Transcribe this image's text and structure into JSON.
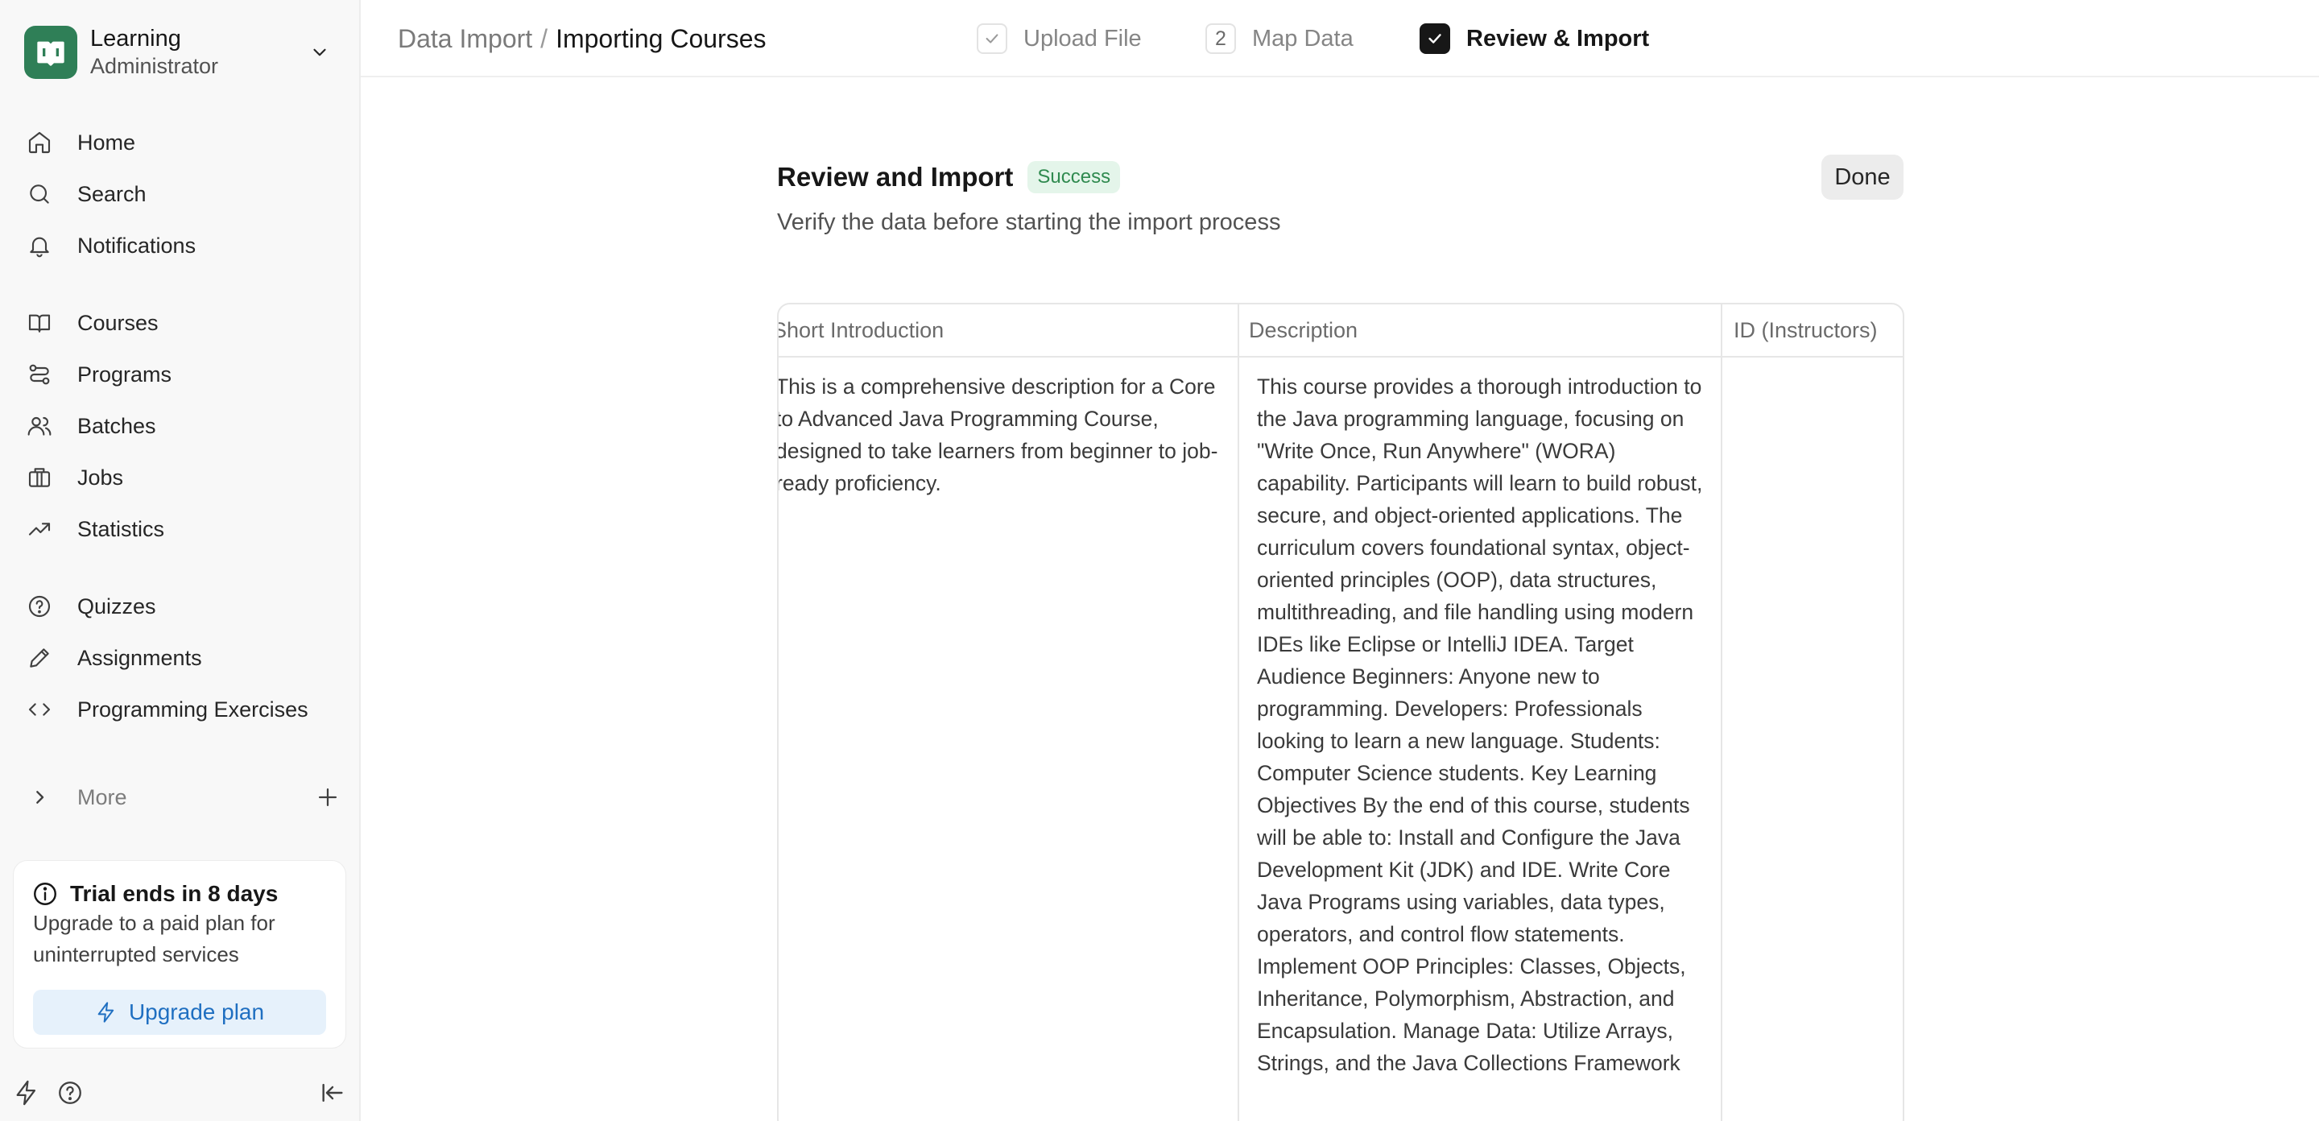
{
  "sidebar": {
    "brand": {
      "title": "Learning",
      "subtitle": "Administrator"
    },
    "nav_primary": [
      {
        "label": "Home",
        "icon": "home-icon"
      },
      {
        "label": "Search",
        "icon": "search-icon"
      },
      {
        "label": "Notifications",
        "icon": "bell-icon"
      }
    ],
    "nav_content": [
      {
        "label": "Courses",
        "icon": "book-icon"
      },
      {
        "label": "Programs",
        "icon": "route-icon"
      },
      {
        "label": "Batches",
        "icon": "users-icon"
      },
      {
        "label": "Jobs",
        "icon": "briefcase-icon"
      },
      {
        "label": "Statistics",
        "icon": "trending-up-icon"
      }
    ],
    "nav_assess": [
      {
        "label": "Quizzes",
        "icon": "help-circle-icon"
      },
      {
        "label": "Assignments",
        "icon": "pencil-icon"
      },
      {
        "label": "Programming Exercises",
        "icon": "code-icon"
      }
    ],
    "more_label": "More",
    "trial": {
      "title": "Trial ends in 8 days",
      "text": "Upgrade to a paid plan for uninterrupted services",
      "button": "Upgrade plan"
    }
  },
  "topbar": {
    "breadcrumb_parent": "Data Import",
    "breadcrumb_separator": "/",
    "breadcrumb_current": "Importing Courses",
    "steps": [
      {
        "marker": "✓",
        "label": "Upload File"
      },
      {
        "marker": "2",
        "label": "Map Data"
      },
      {
        "marker": "✓",
        "label": "Review & Import"
      }
    ]
  },
  "main": {
    "title": "Review and Import",
    "status_badge": "Success",
    "subtitle": "Verify the data before starting the import process",
    "done_label": "Done",
    "table": {
      "columns": [
        "Short Introduction",
        "Description",
        "ID (Instructors)"
      ],
      "rows": [
        {
          "short_introduction": "This is a comprehensive description for a Core to Advanced Java Programming Course, designed to take learners from beginner to job-ready proficiency.",
          "description": "This course provides a thorough introduction to the Java programming language, focusing on \"Write Once, Run Anywhere\" (WORA) capability. Participants will learn to build robust, secure, and object-oriented applications. The curriculum covers foundational syntax, object-oriented principles (OOP), data structures, multithreading, and file handling using modern IDEs like Eclipse or IntelliJ IDEA. Target Audience Beginners: Anyone new to programming. Developers: Professionals looking to learn a new language. Students: Computer Science students. Key Learning Objectives By the end of this course, students will be able to: Install and Configure the Java Development Kit (JDK) and IDE. Write Core Java Programs using variables, data types, operators, and control flow statements. Implement OOP Principles: Classes, Objects, Inheritance, Polymorphism, Abstraction, and Encapsulation. Manage Data: Utilize Arrays, Strings, and the Java Collections Framework",
          "instructors": ""
        }
      ]
    }
  },
  "colors": {
    "brand": "#2f7f57",
    "success_bg": "#e4f5ea",
    "success_text": "#2f8a4f",
    "upgrade_bg": "#e6f1fb",
    "upgrade_text": "#1f6fc1"
  }
}
